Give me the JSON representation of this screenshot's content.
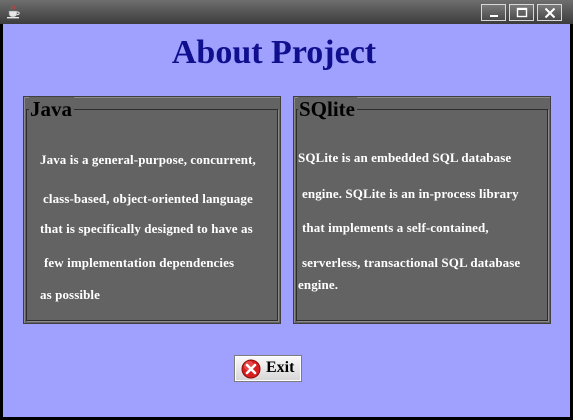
{
  "window": {
    "icon": "java-cup-icon",
    "controls": {
      "minimize": "minimize-icon",
      "maximize": "maximize-icon",
      "close": "close-icon"
    }
  },
  "header": {
    "title": "About Project"
  },
  "panels": [
    {
      "legend": "Java",
      "lines": [
        "Java is a general-purpose, concurrent,",
        "class-based, object-oriented language",
        "that is specifically designed to have as",
        "few implementation dependencies",
        "as possible"
      ]
    },
    {
      "legend": "SQlite",
      "lines": [
        "SQLite is an embedded SQL database",
        "engine. SQLite is an in-process library",
        "that implements a self-contained,",
        "serverless, transactional SQL database",
        "engine."
      ]
    }
  ],
  "exit_button": {
    "label": "Exit",
    "icon": "error-x-icon"
  },
  "colors": {
    "background": "#a0a0ff",
    "title": "#10108e",
    "panel": "#636363",
    "text": "#ffffff"
  }
}
